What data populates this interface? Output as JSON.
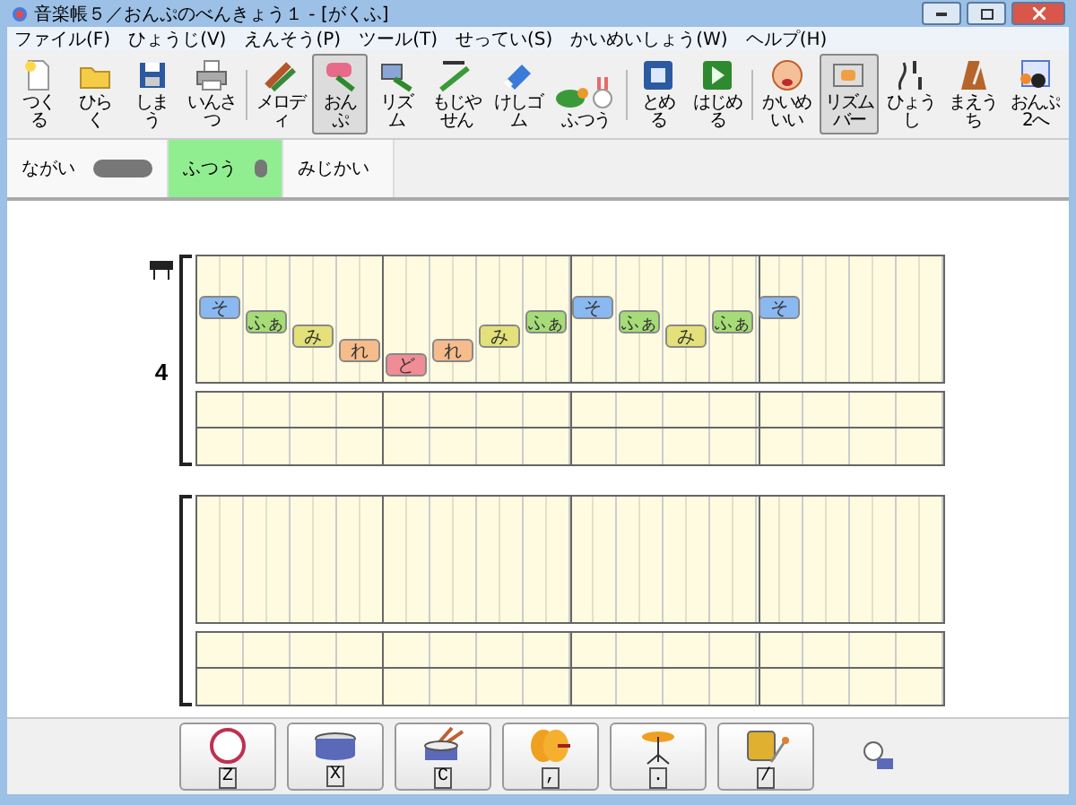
{
  "window": {
    "title": "音楽帳５／おんぷのべんきょう１ - [がくふ]"
  },
  "menu": [
    "ファイル(F)",
    "ひょうじ(V)",
    "えんそう(P)",
    "ツール(T)",
    "せってい(S)",
    "かいめいしょう(W)",
    "ヘルプ(H)"
  ],
  "toolbar": [
    {
      "kind": "new",
      "label": "つくる",
      "selected": false
    },
    {
      "kind": "open",
      "label": "ひらく",
      "selected": false
    },
    {
      "kind": "save",
      "label": "しまう",
      "selected": false
    },
    {
      "kind": "print",
      "label": "いんさつ",
      "selected": false
    },
    {
      "kind": "separator"
    },
    {
      "kind": "melody",
      "label": "メロディ",
      "selected": false
    },
    {
      "kind": "note",
      "label": "おんぷ",
      "selected": true
    },
    {
      "kind": "rhythm",
      "label": "リズム",
      "selected": false
    },
    {
      "kind": "lyric",
      "label": "もじやせん",
      "selected": false
    },
    {
      "kind": "eraser",
      "label": "けしゴム",
      "selected": false
    },
    {
      "kind": "speed",
      "label": "ふつう",
      "selected": false
    },
    {
      "kind": "separator"
    },
    {
      "kind": "stop",
      "label": "とめる",
      "selected": false
    },
    {
      "kind": "play",
      "label": "はじめる",
      "selected": false
    },
    {
      "kind": "separator"
    },
    {
      "kind": "solfege",
      "label": "かいめいい",
      "selected": false
    },
    {
      "kind": "rhythmbar",
      "label": "リズムバー",
      "selected": true
    },
    {
      "kind": "meter",
      "label": "ひょうし",
      "selected": false
    },
    {
      "kind": "countin",
      "label": "まえうち",
      "selected": false
    },
    {
      "kind": "note2",
      "label": "おんぷ2へ",
      "selected": false
    }
  ],
  "lengths": [
    {
      "kind": "long",
      "label": "ながい",
      "selected": false
    },
    {
      "kind": "normal",
      "label": "ふつう",
      "selected": true
    },
    {
      "kind": "short",
      "label": "みじかい",
      "selected": false
    }
  ],
  "score": {
    "meter": "4",
    "notes": [
      {
        "label": "そ",
        "kind": "so",
        "color": "#8ab8f0"
      },
      {
        "label": "ふぁ",
        "kind": "fa",
        "color": "#a6dc78"
      },
      {
        "label": "み",
        "kind": "mi",
        "color": "#e4e07a"
      },
      {
        "label": "れ",
        "kind": "re",
        "color": "#f6bc8c"
      },
      {
        "label": "ど",
        "kind": "do",
        "color": "#f08c96"
      },
      {
        "label": "れ",
        "kind": "re",
        "color": "#f6bc8c"
      },
      {
        "label": "み",
        "kind": "mi",
        "color": "#e4e07a"
      },
      {
        "label": "ふぁ",
        "kind": "fa",
        "color": "#a6dc78"
      },
      {
        "label": "そ",
        "kind": "so",
        "color": "#8ab8f0"
      },
      {
        "label": "ふぁ",
        "kind": "fa",
        "color": "#a6dc78"
      },
      {
        "label": "み",
        "kind": "mi",
        "color": "#e4e07a"
      },
      {
        "label": "ふぁ",
        "kind": "fa",
        "color": "#a6dc78"
      },
      {
        "label": "そ",
        "kind": "so",
        "color": "#8ab8f0"
      }
    ]
  },
  "drum_pads": [
    {
      "kind": "bass",
      "key": "Z"
    },
    {
      "kind": "snare",
      "key": "X"
    },
    {
      "kind": "sticks",
      "key": "C"
    },
    {
      "kind": "cymbal",
      "key": ","
    },
    {
      "kind": "hihat",
      "key": "."
    },
    {
      "kind": "tambourine",
      "key": "/"
    }
  ]
}
